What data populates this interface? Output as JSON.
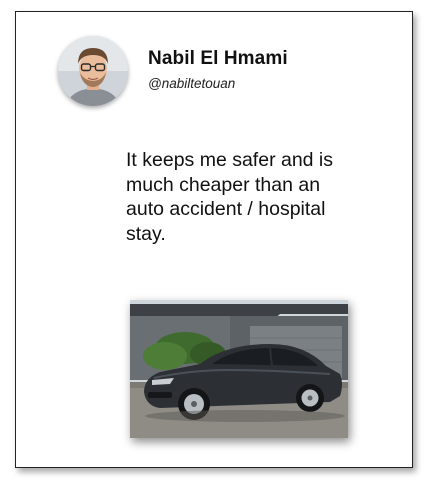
{
  "post": {
    "author_name": "Nabil El Hmami",
    "author_handle": "@nabiltetouan",
    "message": "It keeps me safer and is much cheaper than an auto accident / hospital stay."
  },
  "icons": {
    "avatar": "profile-photo",
    "attachment": "car-photo"
  }
}
